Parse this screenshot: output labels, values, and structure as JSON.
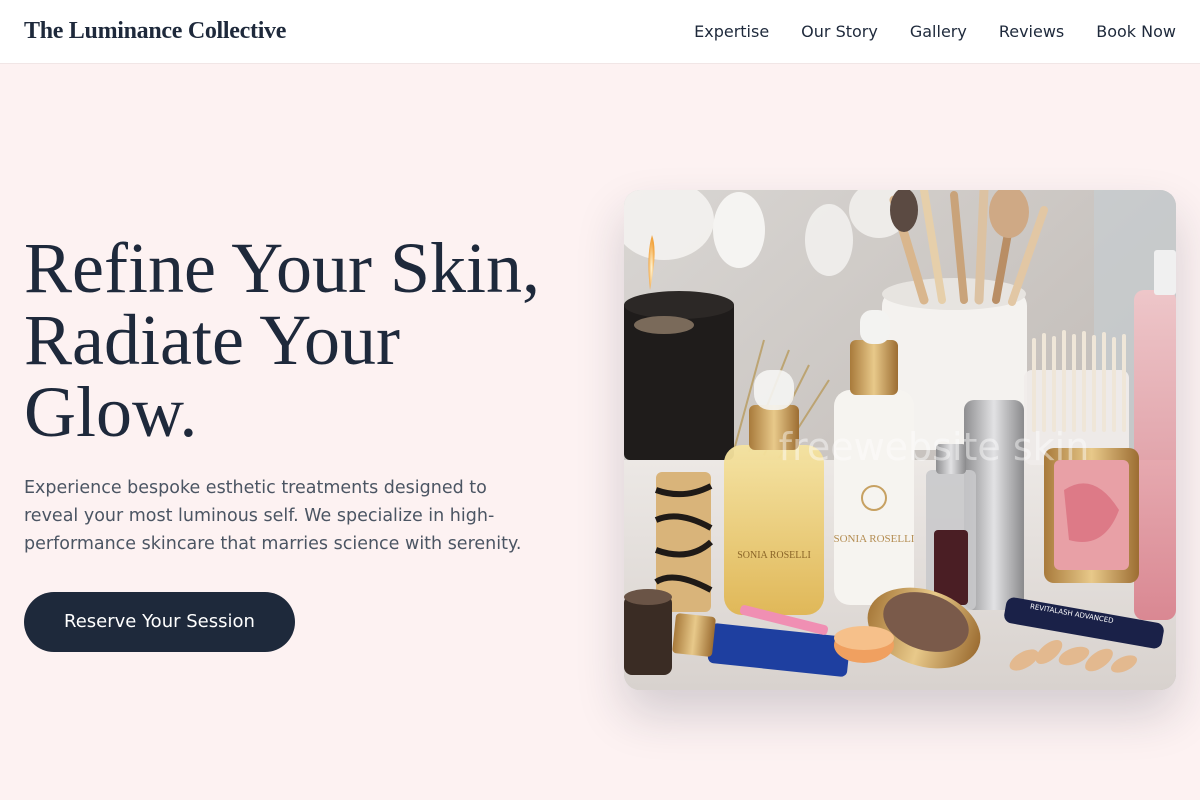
{
  "nav": {
    "brand": "The Luminance Collective",
    "links": [
      "Expertise",
      "Our Story",
      "Gallery",
      "Reviews",
      "Book Now"
    ]
  },
  "hero": {
    "headline_lines": [
      "Refine Your Skin,",
      "Radiate Your",
      "Glow."
    ],
    "description": "Experience bespoke esthetic treatments designed to reveal your most luminous self. We specialize in high-performance skincare that marries science with serenity.",
    "cta_label": "Reserve Your Session"
  },
  "image": {
    "watermark": "freewebsite skin",
    "labels": {
      "serum": "SONIA ROSELLI",
      "lotion": "SONIA ROSELLI",
      "mascara": "REVITALASH ADVANCED"
    }
  },
  "colors": {
    "background": "#fdf2f2",
    "nav_background": "#ffffff",
    "primary_dark": "#1e293b",
    "body_text": "#4b5563"
  }
}
